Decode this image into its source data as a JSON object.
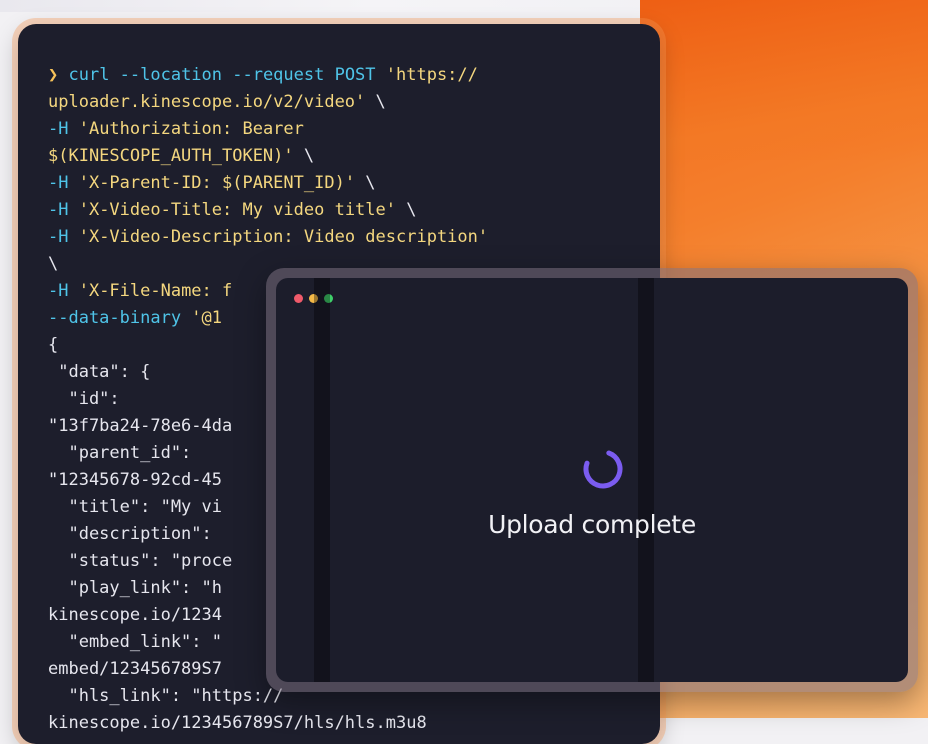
{
  "terminal": {
    "lines": [
      [
        {
          "c": "prompt",
          "t": "❯ "
        },
        {
          "c": "cmd",
          "t": "curl --location --request POST "
        },
        {
          "c": "str",
          "t": "'https://"
        }
      ],
      [
        {
          "c": "str",
          "t": "uploader.kinescope.io/v2/video'"
        },
        {
          "c": "plain",
          "t": " \\"
        }
      ],
      [
        {
          "c": "flag",
          "t": "-H "
        },
        {
          "c": "str",
          "t": "'Authorization: Bearer"
        }
      ],
      [
        {
          "c": "str",
          "t": "$(KINESCOPE_AUTH_TOKEN)'"
        },
        {
          "c": "plain",
          "t": " \\"
        }
      ],
      [
        {
          "c": "flag",
          "t": "-H "
        },
        {
          "c": "str",
          "t": "'X-Parent-ID: $(PARENT_ID)'"
        },
        {
          "c": "plain",
          "t": " \\"
        }
      ],
      [
        {
          "c": "flag",
          "t": "-H "
        },
        {
          "c": "str",
          "t": "'X-Video-Title: My video title'"
        },
        {
          "c": "plain",
          "t": " \\"
        }
      ],
      [
        {
          "c": "flag",
          "t": "-H "
        },
        {
          "c": "str",
          "t": "'X-Video-Description: Video description'"
        }
      ],
      [
        {
          "c": "plain",
          "t": "\\"
        }
      ],
      [
        {
          "c": "flag",
          "t": "-H "
        },
        {
          "c": "str",
          "t": "'X-File-Name: f"
        }
      ],
      [
        {
          "c": "flag",
          "t": "--data-binary "
        },
        {
          "c": "str",
          "t": "'@1"
        }
      ],
      [
        {
          "c": "plain",
          "t": "{"
        }
      ],
      [
        {
          "c": "plain",
          "t": " \"data\": {"
        }
      ],
      [
        {
          "c": "plain",
          "t": "  \"id\":"
        }
      ],
      [
        {
          "c": "plain",
          "t": "\"13f7ba24-78e6-4da"
        }
      ],
      [
        {
          "c": "plain",
          "t": "  \"parent_id\":"
        }
      ],
      [
        {
          "c": "plain",
          "t": "\"12345678-92cd-45"
        }
      ],
      [
        {
          "c": "plain",
          "t": "  \"title\": \"My vi"
        }
      ],
      [
        {
          "c": "plain",
          "t": "  \"description\":"
        }
      ],
      [
        {
          "c": "plain",
          "t": "  \"status\": \"proce"
        }
      ],
      [
        {
          "c": "plain",
          "t": "  \"play_link\": \"h"
        }
      ],
      [
        {
          "c": "plain",
          "t": "kinescope.io/1234"
        }
      ],
      [
        {
          "c": "plain",
          "t": "  \"embed_link\": \""
        }
      ],
      [
        {
          "c": "plain",
          "t": "embed/123456789S7"
        }
      ],
      [
        {
          "c": "plain",
          "t": "  \"hls_link\": \"https://"
        }
      ],
      [
        {
          "c": "plain",
          "t": "kinescope.io/123456789S7/hls/hls.m3u8"
        }
      ]
    ]
  },
  "modal": {
    "status_text": "Upload complete"
  },
  "colors": {
    "accent_spinner": "#7b5cf0",
    "terminal_bg": "#1d1e2c",
    "orange": "#f47f2c"
  }
}
